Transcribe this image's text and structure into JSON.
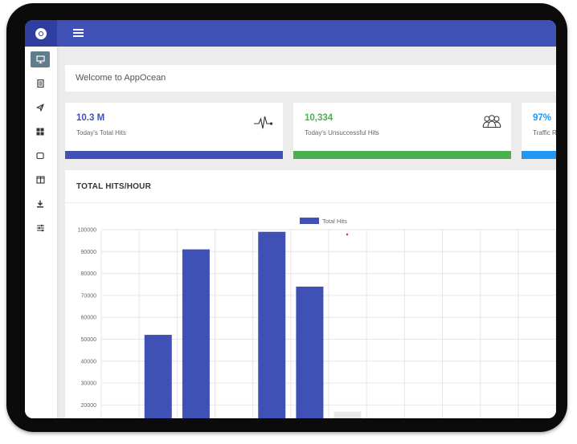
{
  "app": {
    "welcome_text": "Welcome to AppOcean"
  },
  "topbar": {
    "menu_icon": "hamburger-icon",
    "logo_icon": "disc-logo-icon",
    "color": "#3f51b5",
    "logo_bg": "#303f9f"
  },
  "sidebar": {
    "items": [
      {
        "icon": "monitor-icon",
        "active": true
      },
      {
        "icon": "document-icon",
        "active": false
      },
      {
        "icon": "send-icon",
        "active": false
      },
      {
        "icon": "grid-icon",
        "active": false
      },
      {
        "icon": "square-icon",
        "active": false
      },
      {
        "icon": "columns-icon",
        "active": false
      },
      {
        "icon": "download-icon",
        "active": false
      },
      {
        "icon": "sliders-icon",
        "active": false
      }
    ],
    "active_color": "#607d8b"
  },
  "cards": [
    {
      "value": "10.3 M",
      "label": "Today's Total Hits",
      "color": "#3f51b5",
      "icon": "pulse-icon"
    },
    {
      "value": "10,334",
      "label": "Today's Unsuccessful Hits",
      "color": "#4caf50",
      "icon": "users-icon"
    },
    {
      "value": "97%",
      "label": "Traffic R",
      "color": "#2196f3",
      "icon": ""
    }
  ],
  "chart_panel": {
    "title": "TOTAL HITS/HOUR"
  },
  "chart_data": {
    "type": "bar",
    "series": [
      {
        "name": "Total Hits",
        "color": "#3f51b5",
        "values": [
          null,
          52000,
          91000,
          null,
          99000,
          74000,
          17000,
          null,
          null,
          null,
          null,
          null
        ]
      }
    ],
    "categories_visible": false,
    "yticks": [
      100000,
      90000,
      80000,
      70000,
      60000,
      50000,
      40000,
      30000,
      20000
    ],
    "ylim_visible": [
      15000,
      100000
    ],
    "grid": true,
    "legend": "top-center",
    "highlight_bar_color": "#e8e8e8"
  }
}
